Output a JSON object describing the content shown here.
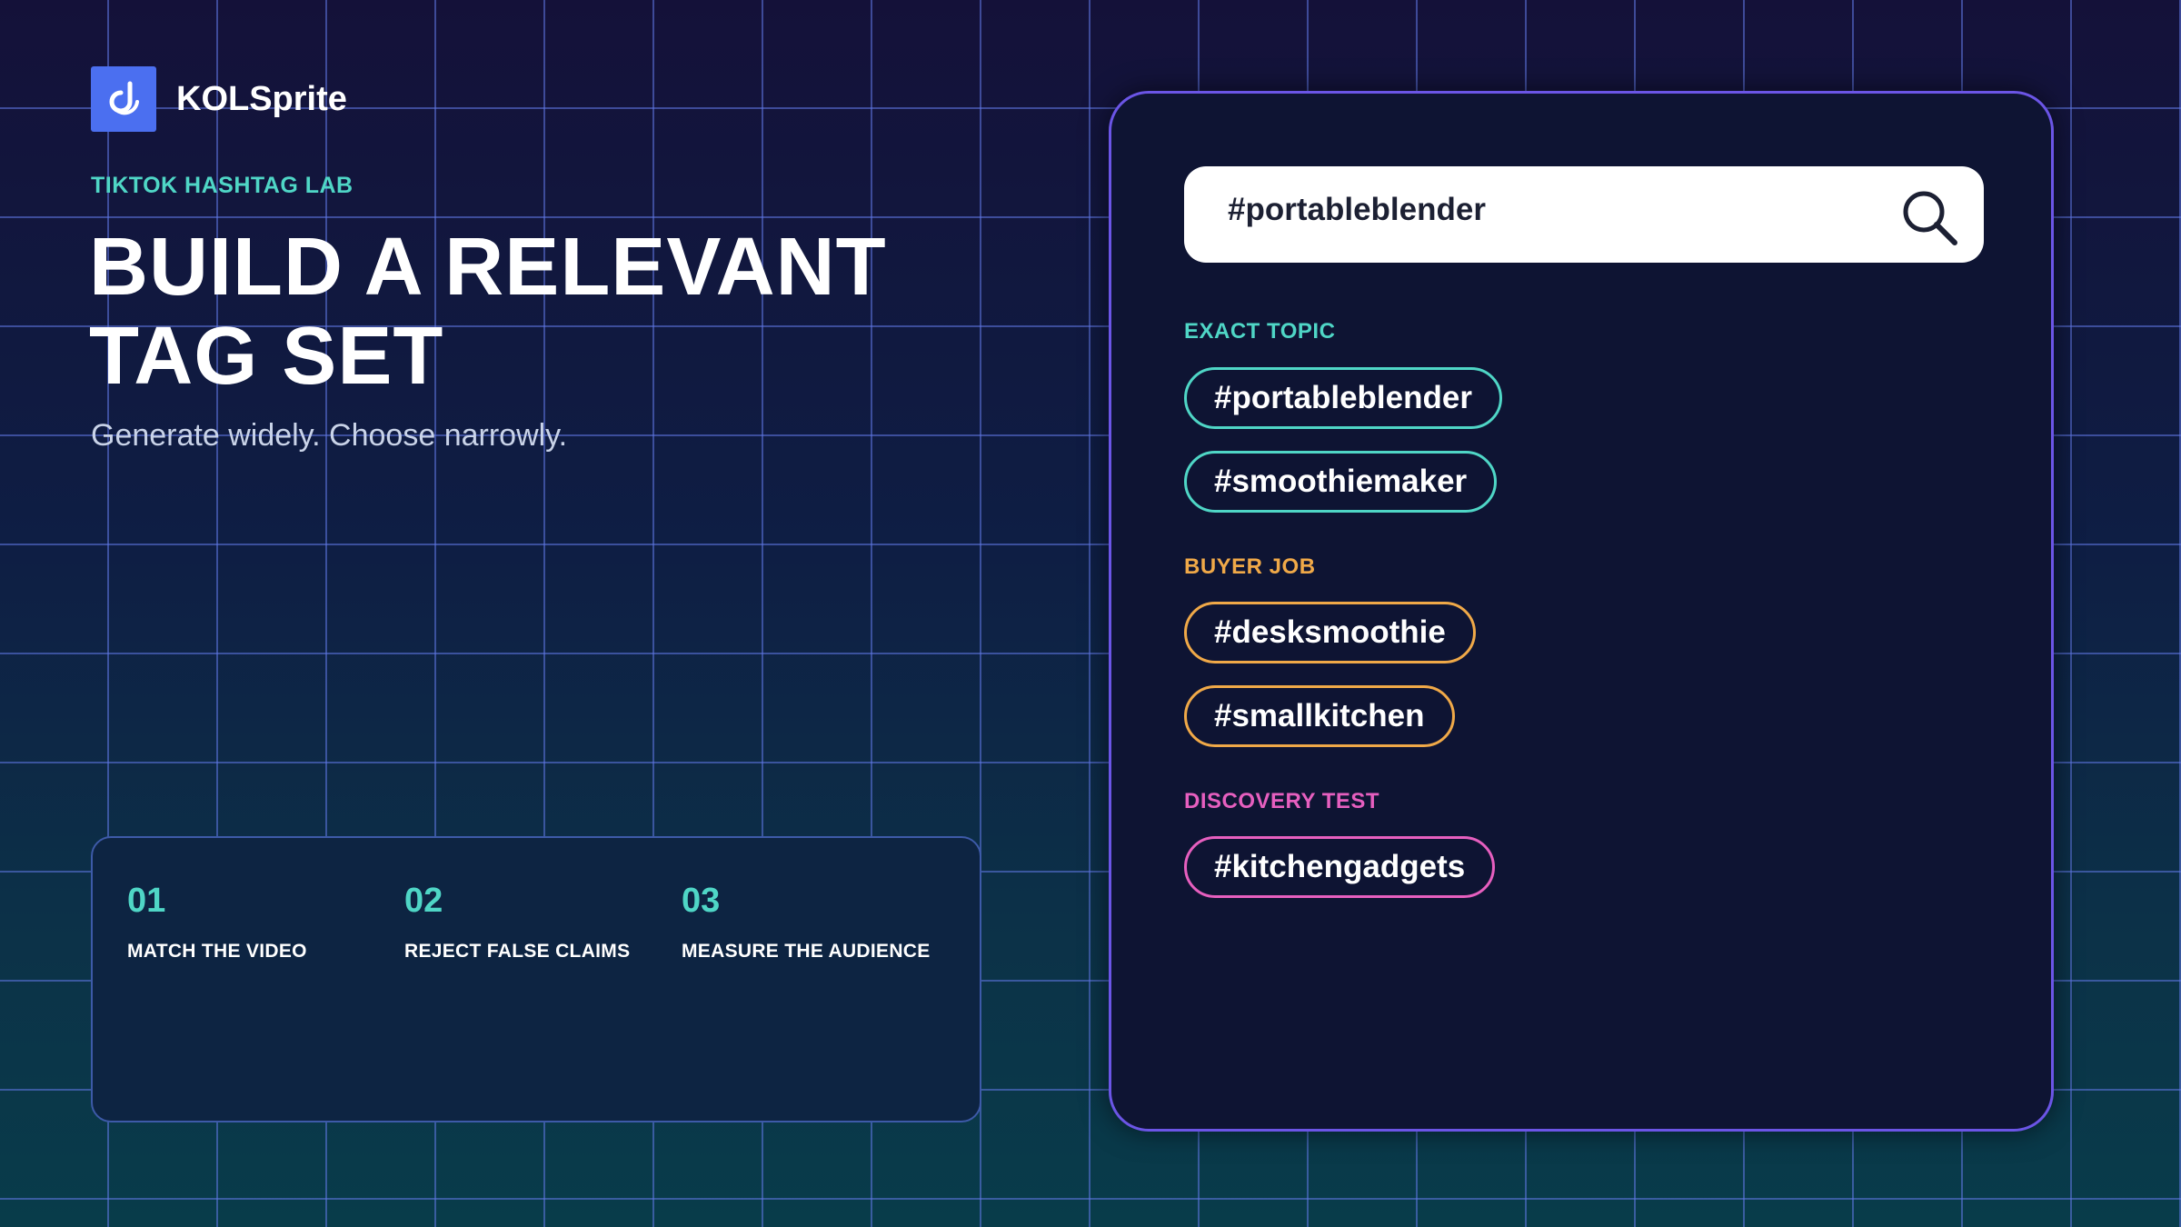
{
  "brand": {
    "name": "KOLSprite",
    "logo_icon": "kolsprite-logo-icon"
  },
  "hero": {
    "eyebrow": "TIKTOK HASHTAG LAB",
    "headline_line1": "BUILD A RELEVANT",
    "headline_line2": "TAG SET",
    "subheadline": "Generate widely. Choose narrowly."
  },
  "steps": [
    {
      "number": "01",
      "label": "MATCH THE VIDEO"
    },
    {
      "number": "02",
      "label": "REJECT FALSE CLAIMS"
    },
    {
      "number": "03",
      "label": "MEASURE THE AUDIENCE"
    }
  ],
  "search": {
    "value": "#portableblender",
    "icon": "search-icon"
  },
  "groups": [
    {
      "title": "EXACT TOPIC",
      "color": "#4fd6c6",
      "tags": [
        "#portableblender",
        "#smoothiemaker"
      ]
    },
    {
      "title": "BUYER JOB",
      "color": "#f0a948",
      "tags": [
        "#desksmoothie",
        "#smallkitchen"
      ]
    },
    {
      "title": "DISCOVERY TEST",
      "color": "#e65fbf",
      "tags": [
        "#kitchengadgets"
      ]
    }
  ],
  "colors": {
    "accent_teal": "#4fd6c6",
    "accent_orange": "#f0a948",
    "accent_pink": "#e65fbf",
    "panel_border": "#6b55e6",
    "logo_blue": "#4b6ff0"
  }
}
